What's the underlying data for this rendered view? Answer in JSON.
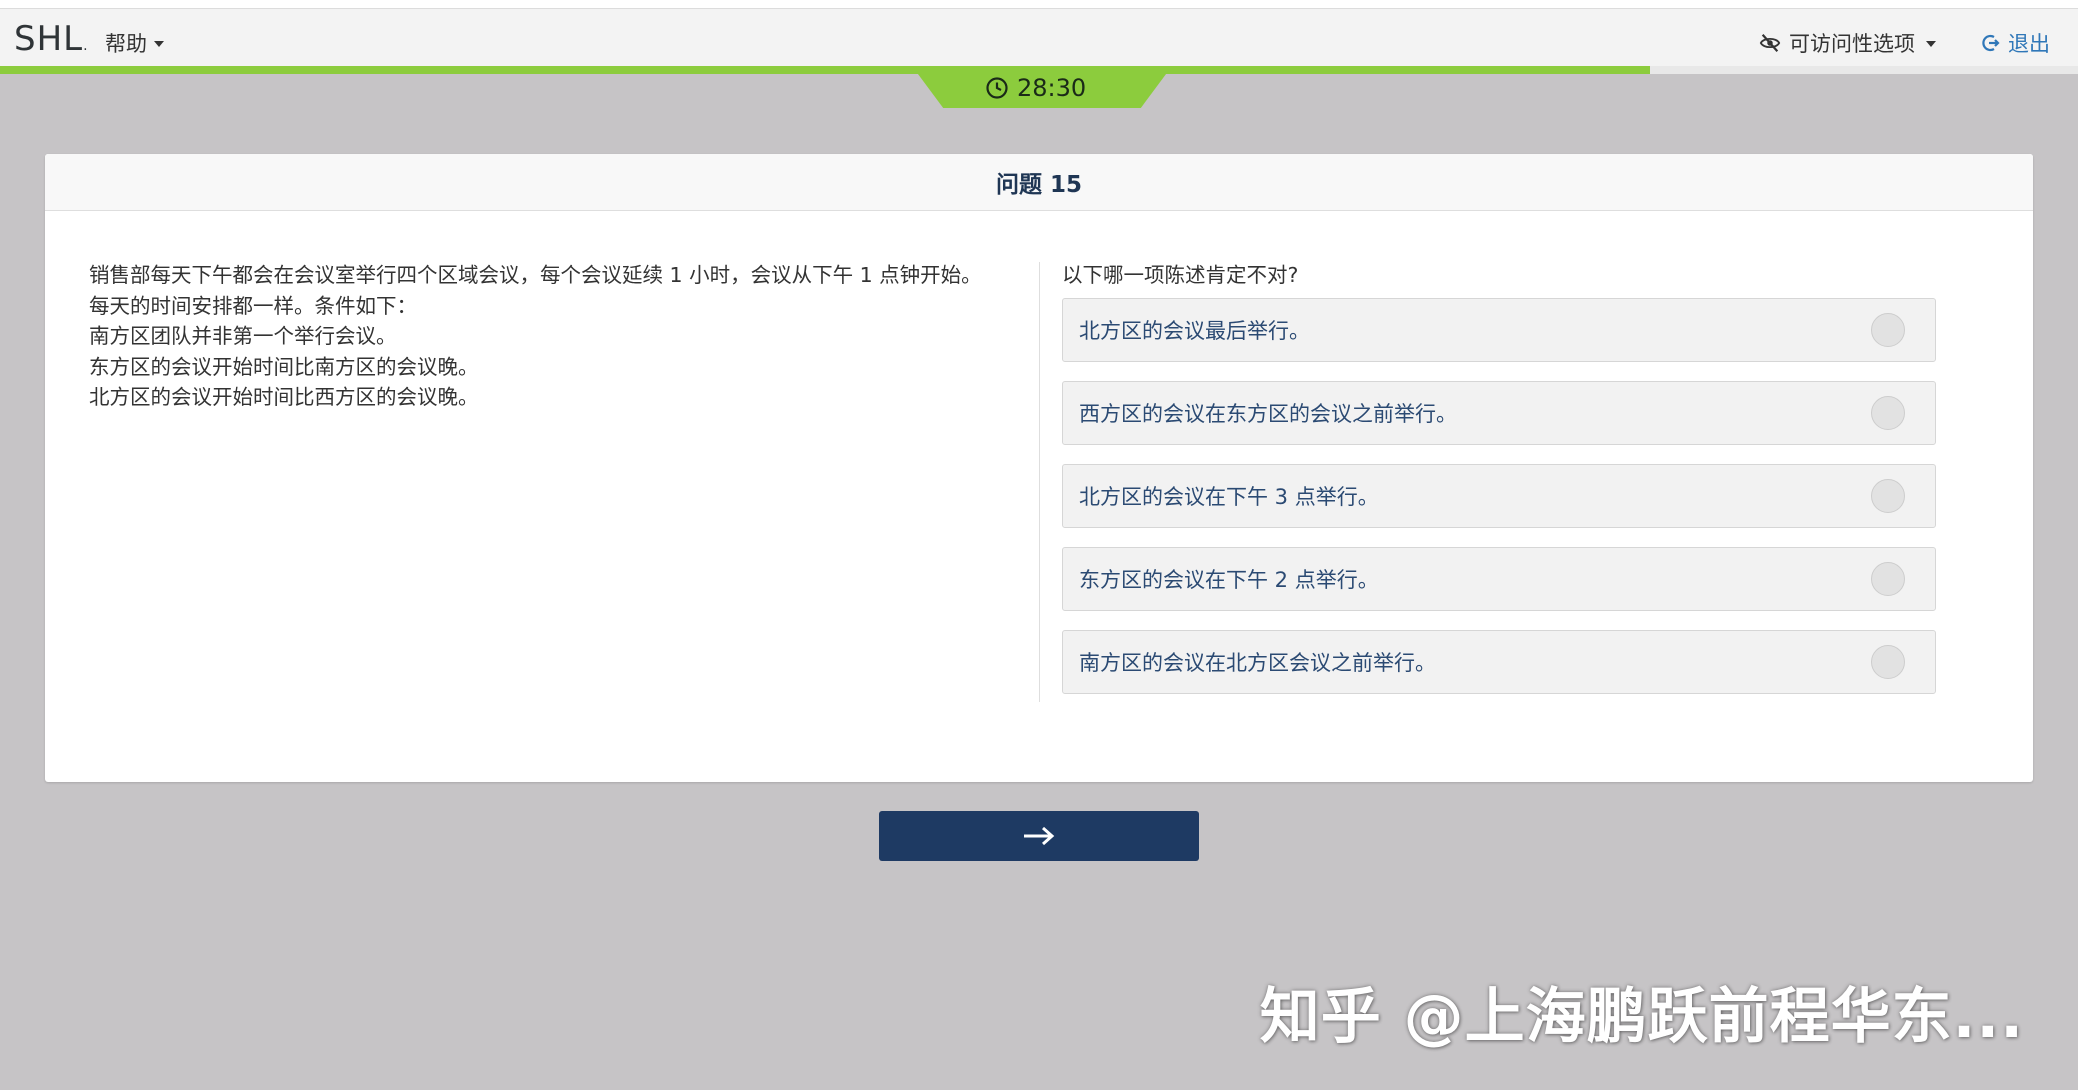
{
  "header": {
    "logo": "SHL",
    "help_label": "帮助",
    "accessibility_label": "可访问性选项",
    "logout_label": "退出"
  },
  "progress": {
    "percent": 79.4
  },
  "timer": {
    "value": "28:30"
  },
  "question": {
    "title": "问题 15",
    "passage": [
      "销售部每天下午都会在会议室举行四个区域会议，每个会议延续 1 小时，会议从下午 1 点钟开始。每天的时间安排都一样。条件如下：",
      "南方区团队并非第一个举行会议。",
      "东方区的会议开始时间比南方区的会议晚。",
      "北方区的会议开始时间比西方区的会议晚。"
    ],
    "prompt": "以下哪一项陈述肯定不对?",
    "options": [
      "北方区的会议最后举行。",
      "西方区的会议在东方区的会议之前举行。",
      "北方区的会议在下午 3 点举行。",
      "东方区的会议在下午 2 点举行。",
      "南方区的会议在北方区会议之前举行。"
    ]
  },
  "watermark": "知乎 @上海鹏跃前程华东...",
  "colors": {
    "accent_green": "#8ccc3d",
    "navy": "#1e3a63",
    "option_text": "#2b4a73",
    "link_blue": "#2f77b8"
  }
}
